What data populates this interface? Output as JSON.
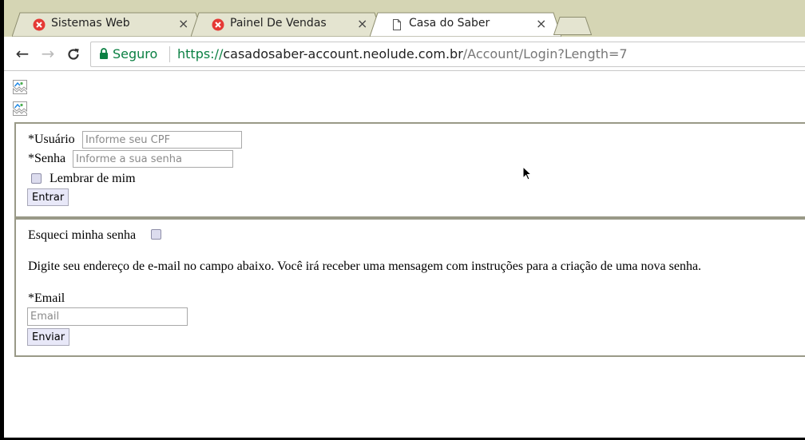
{
  "tabs": [
    {
      "label": "Sistemas Web",
      "icon": "red-circle-favicon-icon",
      "close": "×"
    },
    {
      "label": "Painel De Vendas",
      "icon": "red-circle-favicon-icon",
      "close": "×"
    },
    {
      "label": "Casa do Saber",
      "icon": "page-icon",
      "close": "×",
      "active": true
    }
  ],
  "toolbar": {
    "back": "←",
    "forward": "→",
    "reload": "C",
    "secure_label": "Seguro",
    "url_scheme": "https://",
    "url_host": "casadosaber-account.neolude.com.br",
    "url_path": "/Account/Login?Length=7"
  },
  "login": {
    "user_label": "*Usuário",
    "user_placeholder": "Informe seu CPF",
    "password_label": "*Senha",
    "password_placeholder": "Informe a sua senha",
    "remember_label": "Lembrar de mim",
    "submit_label": "Entrar"
  },
  "recover": {
    "forgot_label": "Esqueci minha senha",
    "instructions": "Digite seu endereço de e-mail no campo abaixo. Você irá receber uma mensagem com instruções para a criação de uma nova senha.",
    "email_label": "*Email",
    "email_placeholder": "Email",
    "submit_label": "Enviar"
  },
  "colors": {
    "tabstrip": "#d5d5b4",
    "secure_green": "#0b8043",
    "favicon_red": "#e53935",
    "fieldset_border": "#999987"
  }
}
